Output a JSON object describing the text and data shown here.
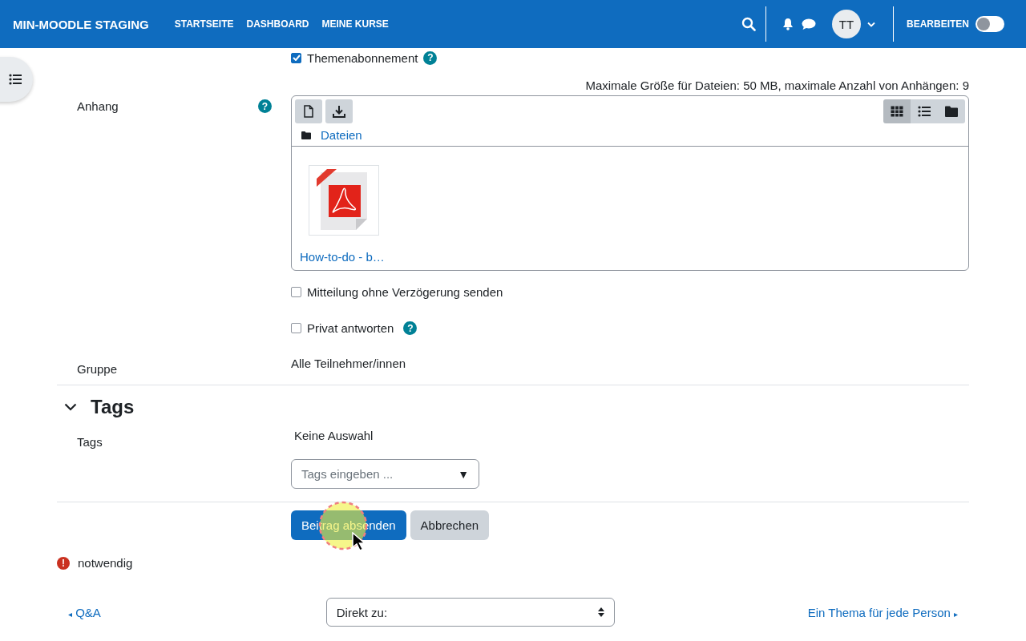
{
  "navbar": {
    "brand": "MIN-MOODLE STAGING",
    "links": [
      "STARTSEITE",
      "DASHBOARD",
      "MEINE KURSE"
    ],
    "avatar": "TT",
    "edit_mode": {
      "label": "BEARBEITEN",
      "on": false
    }
  },
  "form": {
    "subscription": {
      "label": "Themenabonnement",
      "checked": true,
      "help": "?"
    },
    "attachment": {
      "label": "Anhang",
      "help": "?",
      "limits": "Maximale Größe für Dateien: 50 MB, maximale Anzahl von Anhängen: 9",
      "views": [
        {
          "kind": "grid",
          "selected": true
        },
        {
          "kind": "list",
          "selected": false
        },
        {
          "kind": "tree",
          "selected": false
        }
      ],
      "path": "Dateien",
      "files": [
        {
          "name": "How-to-do - b…"
        }
      ]
    },
    "options": [
      {
        "label": "Mitteilung ohne Verzögerung senden",
        "checked": false
      },
      {
        "label": "Privat antworten",
        "checked": false,
        "help": "?"
      }
    ],
    "group": {
      "label": "Gruppe",
      "value": "Alle Teilnehmer/innen"
    },
    "tags_section": {
      "title": "Tags",
      "expanded": true,
      "label": "Tags",
      "selection": "Keine Auswahl",
      "placeholder": "Tags eingeben ...",
      "arrow": "▼"
    },
    "buttons": [
      {
        "label": "Beitrag absenden",
        "kind": "primary"
      },
      {
        "label": "Abbrechen",
        "kind": "secondary"
      }
    ],
    "required_note": {
      "icon": "!",
      "text": "notwendig"
    }
  },
  "footer": {
    "prev": {
      "arrow": "◂",
      "label": "Q&A"
    },
    "jump": "Direkt zu:",
    "next": {
      "label": "Ein Thema für jede Person",
      "arrow": "▸"
    }
  }
}
